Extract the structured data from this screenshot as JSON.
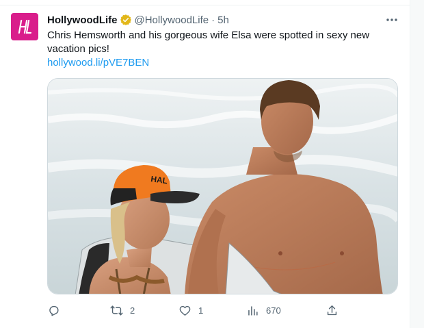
{
  "tweet": {
    "display_name": "HollywoodLife",
    "handle": "@HollywoodLife",
    "separator": "·",
    "time": "5h",
    "text": "Chris Hemsworth and his gorgeous wife Elsa were spotted in sexy new vacation pics!",
    "link": "hollywood.li/pVE7BEN",
    "avatar_icon": "hl-logo-icon",
    "cap_text": "HAL",
    "verified_icon": "verified-badge-icon",
    "more_icon": "more-dots-icon"
  },
  "actions": {
    "reply": {
      "icon": "reply-icon",
      "count": ""
    },
    "retweet": {
      "icon": "retweet-icon",
      "count": "2"
    },
    "like": {
      "icon": "heart-icon",
      "count": "1"
    },
    "views": {
      "icon": "views-chart-icon",
      "count": "670"
    },
    "share": {
      "icon": "share-icon",
      "count": ""
    }
  },
  "colors": {
    "brand_pink": "#d91d8b",
    "link_blue": "#1d9bf0",
    "verified_gold": "#e2b719",
    "text_primary": "#0f1419",
    "text_secondary": "#536471"
  }
}
